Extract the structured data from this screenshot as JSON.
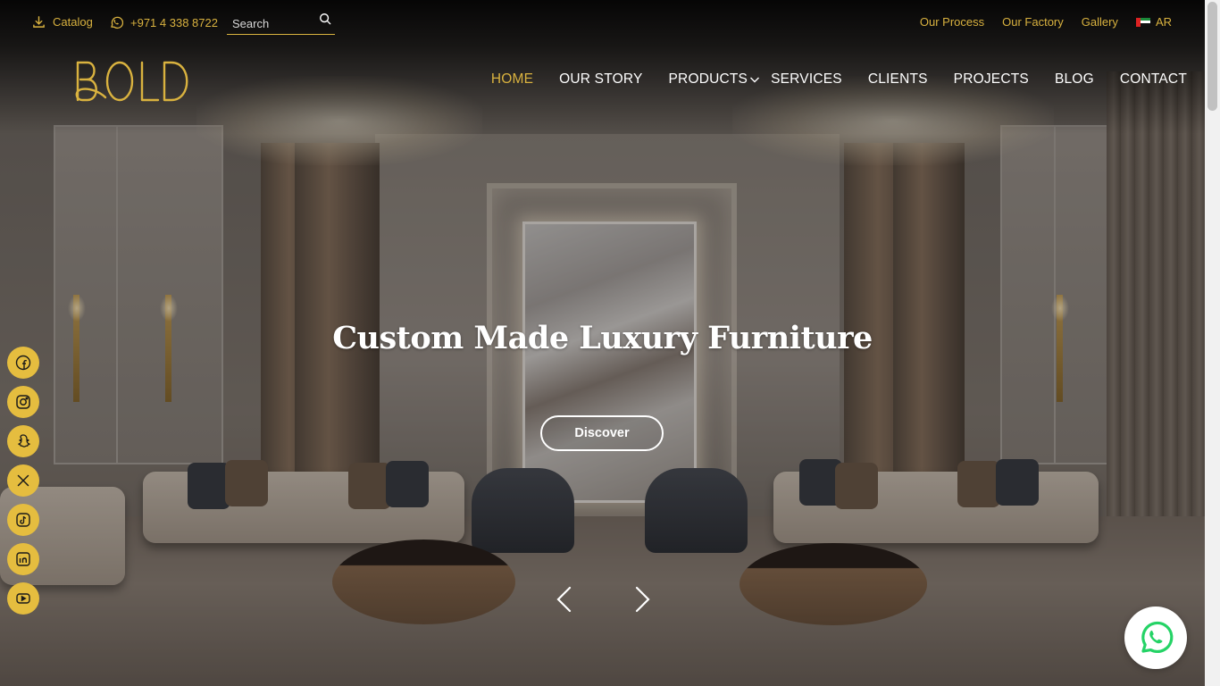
{
  "brand": {
    "logo_text": "BOLD",
    "accent": "#d9b23f"
  },
  "topbar": {
    "catalog_label": "Catalog",
    "phone": "+971 4 338 8722",
    "search": {
      "placeholder": "Search"
    },
    "links": [
      "Our Process",
      "Our Factory",
      "Gallery"
    ],
    "language": "AR"
  },
  "nav": {
    "items": [
      "HOME",
      "OUR STORY",
      "PRODUCTS",
      "SERVICES",
      "CLIENTS",
      "PROJECTS",
      "BLOG",
      "CONTACT"
    ],
    "active": "HOME"
  },
  "hero": {
    "title": "Custom Made Luxury Furniture",
    "cta": "Discover"
  },
  "social": [
    "facebook",
    "instagram",
    "snapchat",
    "x",
    "tiktok",
    "linkedin",
    "youtube"
  ],
  "icons": {
    "catalog": "download-icon",
    "phone": "whatsapp-icon",
    "search": "search-icon",
    "float": "whatsapp-float-icon"
  }
}
